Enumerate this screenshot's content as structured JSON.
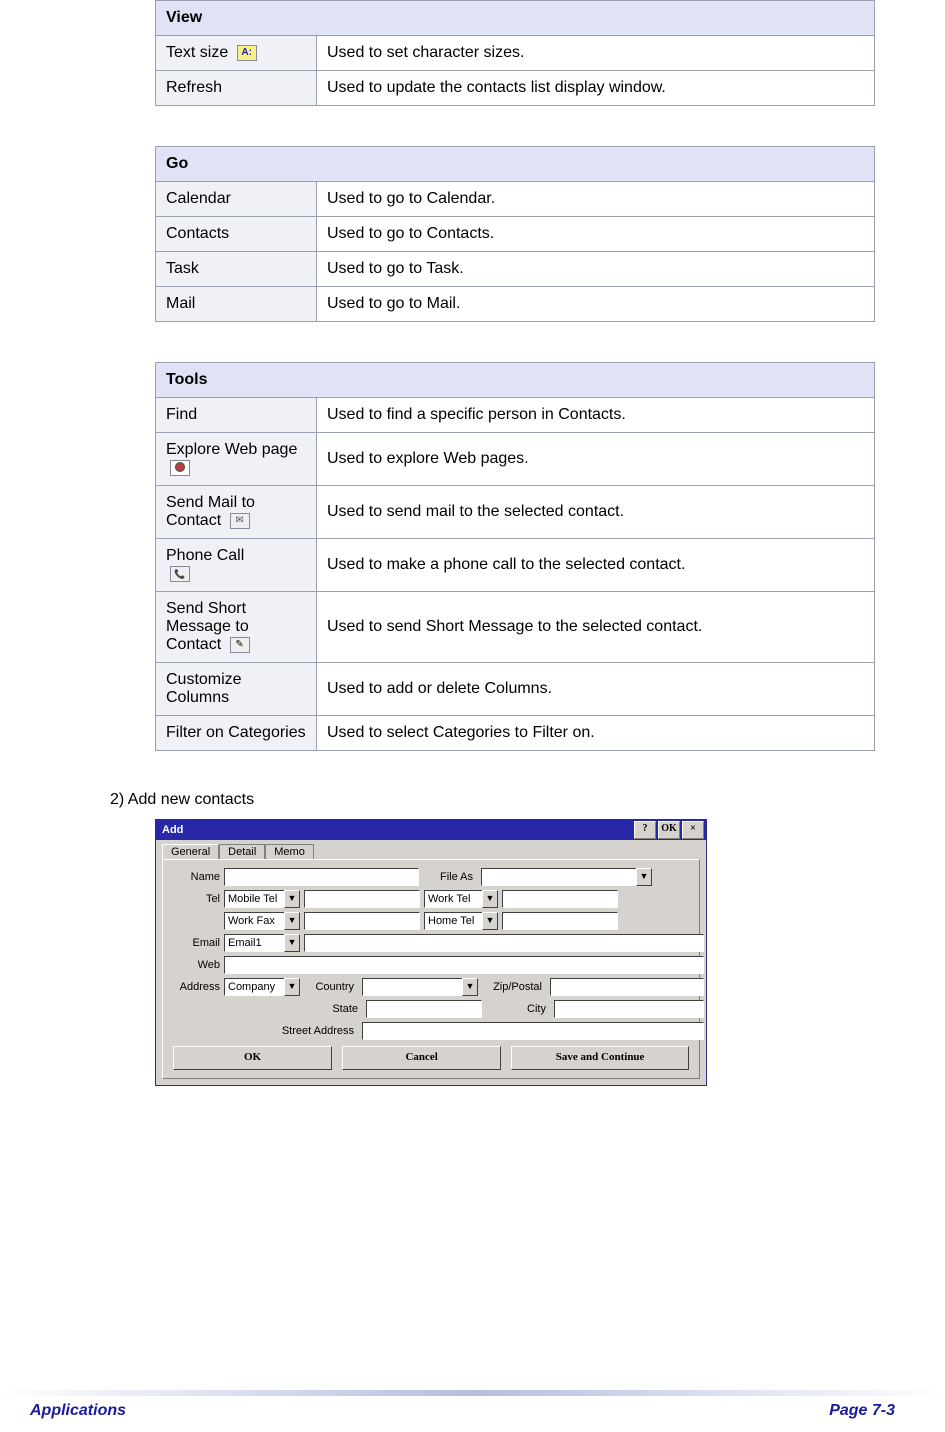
{
  "sections": {
    "view": {
      "title": "View",
      "rows": {
        "textSize": {
          "label": "Text size",
          "desc": "Used to set character sizes."
        },
        "refresh": {
          "label": "Refresh",
          "desc": "Used to update the contacts list display window."
        }
      }
    },
    "go": {
      "title": "Go",
      "rows": {
        "calendar": {
          "label": "Calendar",
          "desc": "Used to go to Calendar."
        },
        "contacts": {
          "label": "Contacts",
          "desc": "Used to go to Contacts."
        },
        "task": {
          "label": "Task",
          "desc": "Used to go to Task."
        },
        "mail": {
          "label": "Mail",
          "desc": "Used to go to Mail."
        }
      }
    },
    "tools": {
      "title": "Tools",
      "rows": {
        "find": {
          "label": "Find",
          "desc": "Used to find a specific person in Contacts."
        },
        "explore": {
          "label": "Explore Web page",
          "desc": "Used to explore Web pages."
        },
        "sendMail": {
          "label": "Send Mail to Contact",
          "desc": "Used to send mail to the selected contact."
        },
        "phone": {
          "label": "Phone Call",
          "desc": "Used to make a phone call to the selected contact."
        },
        "sms": {
          "label": "Send Short Message to Contact",
          "desc": "Used to send Short Message to the selected contact."
        },
        "columns": {
          "label": "Customize Columns",
          "desc": "Used to add or delete Columns."
        },
        "filter": {
          "label": "Filter on Categories",
          "desc": "Used to select Categories to Filter on."
        }
      }
    }
  },
  "step": {
    "text": "2)   Add new contacts"
  },
  "dialog": {
    "title": "Add",
    "btns": {
      "help": "?",
      "ok": "OK",
      "close": "×"
    },
    "tabs": {
      "general": "General",
      "detail": "Detail",
      "memo": "Memo"
    },
    "labels": {
      "name": "Name",
      "fileAs": "File As",
      "tel": "Tel",
      "email": "Email",
      "web": "Web",
      "address": "Address",
      "country": "Country",
      "zip": "Zip/Postal",
      "state": "State",
      "city": "City",
      "street": "Street Address"
    },
    "combos": {
      "mobileTel": "Mobile Tel",
      "workTel": "Work Tel",
      "workFax": "Work Fax",
      "homeTel": "Home Tel",
      "email1": "Email1",
      "company": "Company"
    },
    "buttons": {
      "ok": "OK",
      "cancel": "Cancel",
      "save": "Save and Continue"
    }
  },
  "footer": {
    "left": "Applications",
    "right": "Page 7-3"
  },
  "icons": {
    "textSize": "A",
    "dropdown": "▼"
  }
}
